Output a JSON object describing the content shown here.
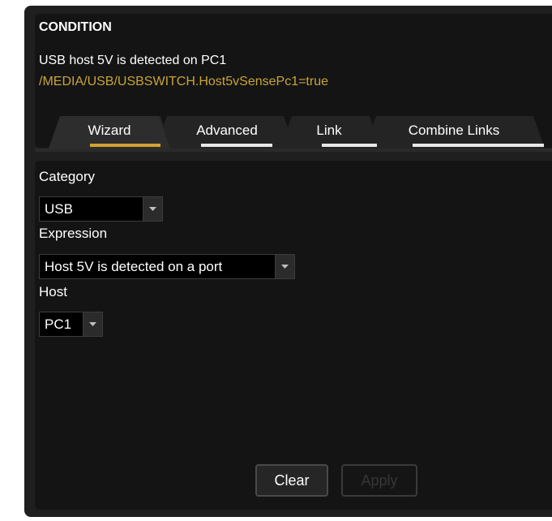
{
  "condition": {
    "title": "CONDITION",
    "description": "USB host 5V is detected on PC1",
    "path": "/MEDIA/USB/USBSWITCH.Host5vSensePc1=true"
  },
  "tabs": [
    {
      "label": "Wizard",
      "active": true
    },
    {
      "label": "Advanced",
      "active": false
    },
    {
      "label": "Link",
      "active": false
    },
    {
      "label": "Combine Links",
      "active": false
    }
  ],
  "form": {
    "category_label": "Category",
    "category_value": "USB",
    "expression_label": "Expression",
    "expression_value": "Host 5V is detected on a port",
    "host_label": "Host",
    "host_value": "PC1"
  },
  "buttons": {
    "clear_label": "Clear",
    "apply_label": "Apply"
  },
  "colors": {
    "accent": "#d2a230",
    "path_text": "#c9a43a",
    "panel_bg": "#141414"
  }
}
